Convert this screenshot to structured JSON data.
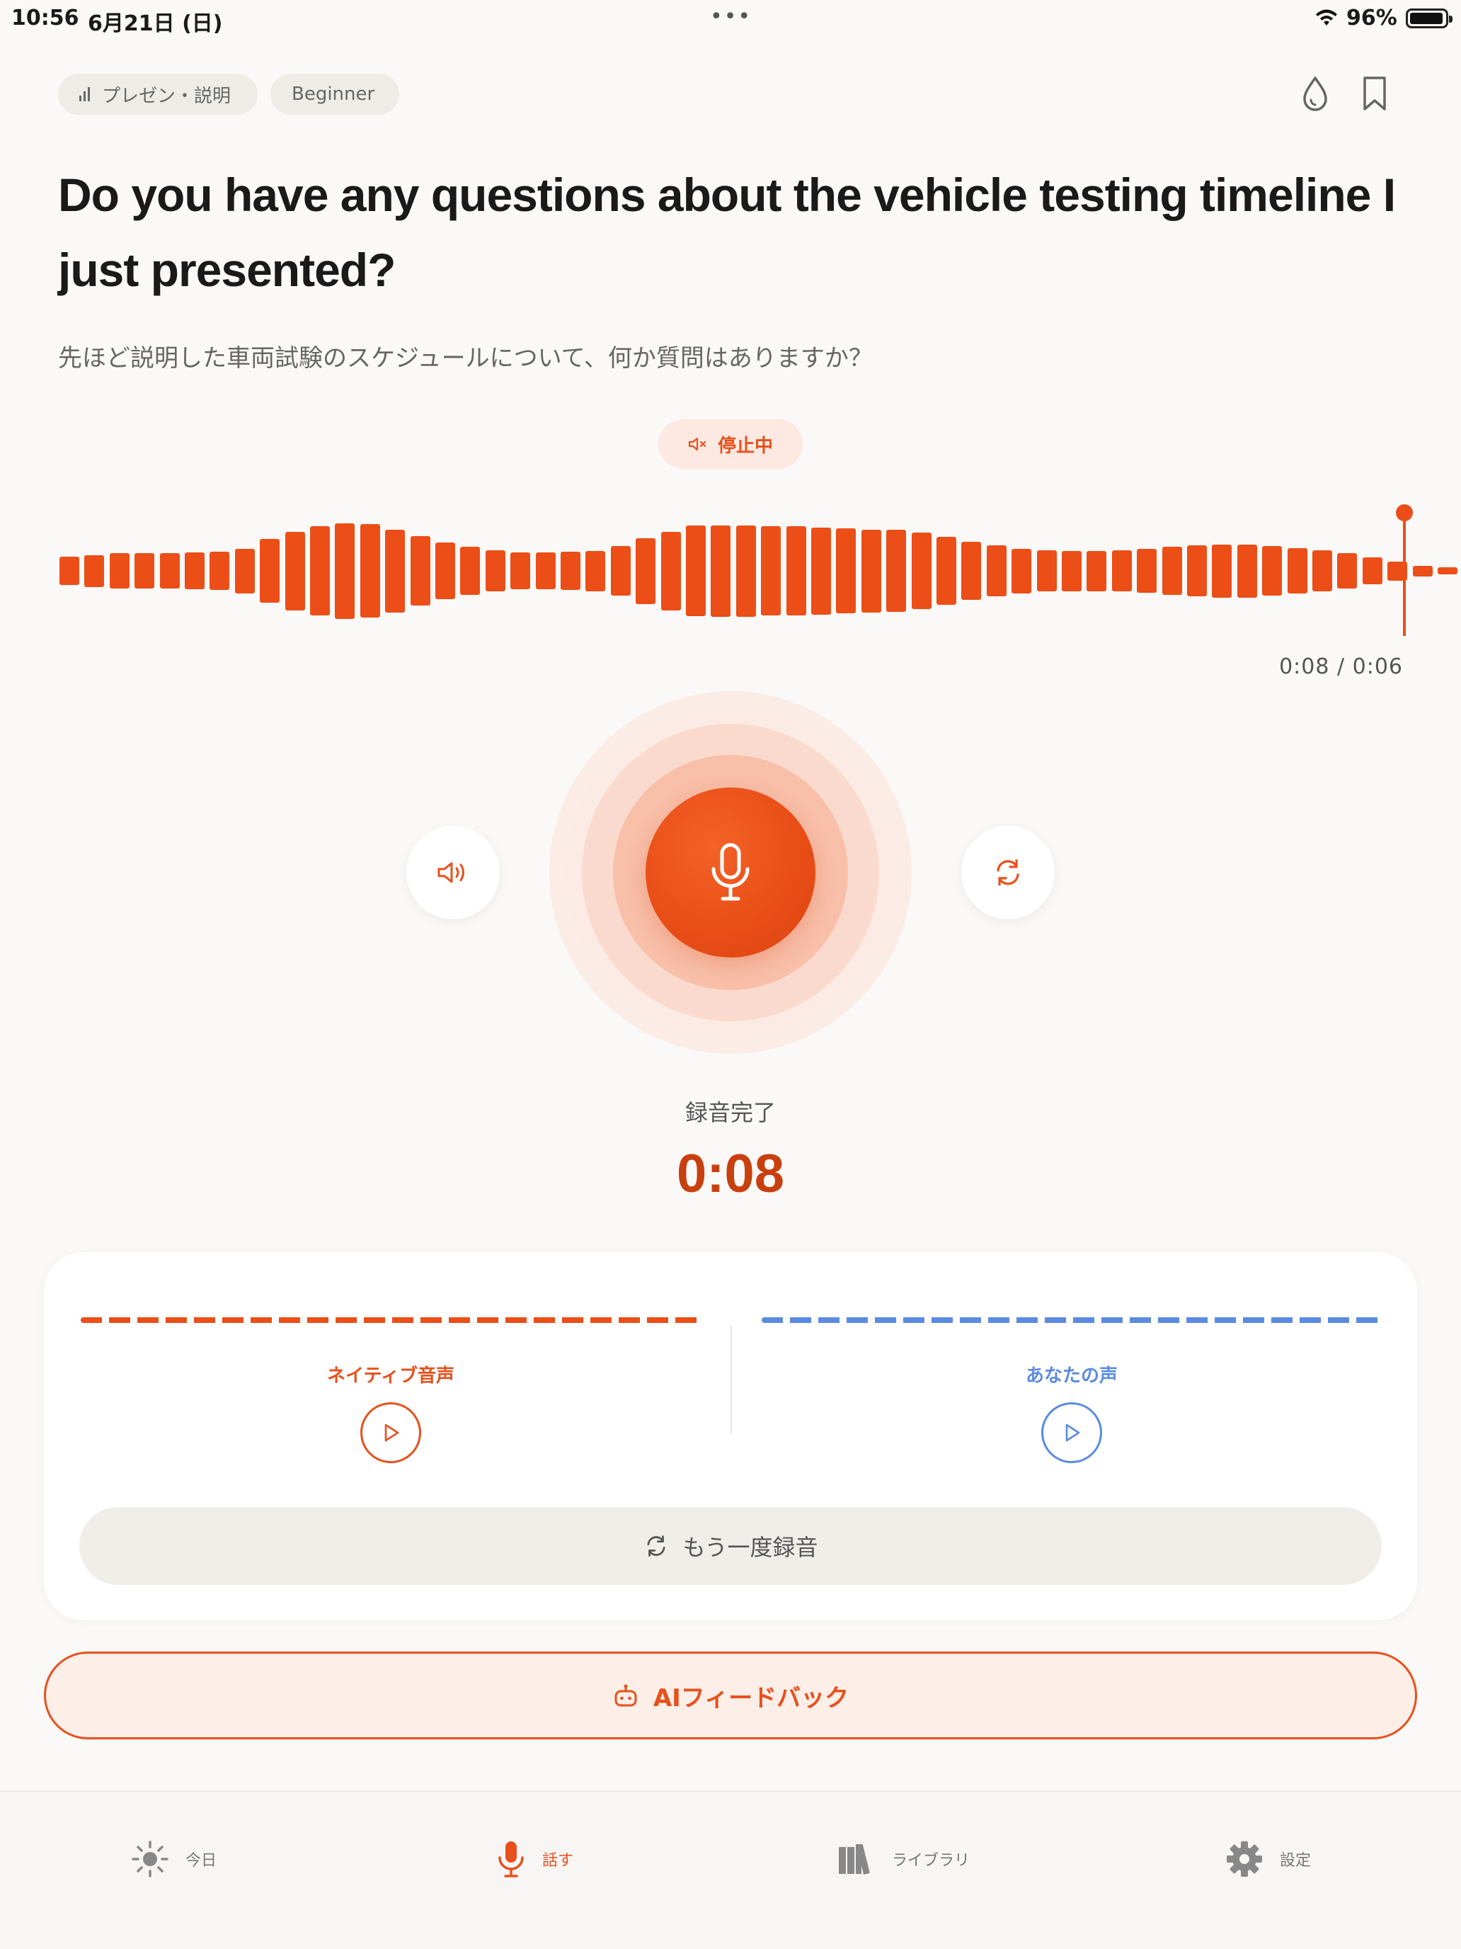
{
  "status_bar": {
    "time": "10:56",
    "date": "6月21日 (日)",
    "dots": "•••",
    "battery_percent": "96%",
    "battery_level": 0.96
  },
  "tags": {
    "category": "プレゼン・説明",
    "level": "Beginner"
  },
  "question": {
    "english": "Do you have any questions about the vehicle testing timeline I just presented?",
    "japanese": "先ほど説明した車両試験のスケジュールについて、何か質問はありますか？"
  },
  "playback_state": {
    "label": "停止中"
  },
  "waveform": {
    "color": "#ec4e18",
    "levels": [
      0.27,
      0.3,
      0.33,
      0.33,
      0.33,
      0.35,
      0.36,
      0.42,
      0.6,
      0.74,
      0.84,
      0.9,
      0.88,
      0.78,
      0.65,
      0.53,
      0.45,
      0.39,
      0.35,
      0.35,
      0.36,
      0.38,
      0.47,
      0.62,
      0.74,
      0.85,
      0.86,
      0.86,
      0.84,
      0.84,
      0.82,
      0.8,
      0.78,
      0.77,
      0.72,
      0.64,
      0.55,
      0.48,
      0.42,
      0.39,
      0.38,
      0.38,
      0.39,
      0.41,
      0.45,
      0.48,
      0.5,
      0.5,
      0.47,
      0.43,
      0.39,
      0.33,
      0.25,
      0.18,
      0.1,
      0.07,
      0.06
    ],
    "time_readout": "0:08 / 0:06"
  },
  "recording": {
    "status": "録音完了",
    "duration": "0:08"
  },
  "compare": {
    "native_label": "ネイティブ音声",
    "your_label": "あなたの声",
    "native_color": "#e8501c",
    "your_color": "#5b8be0",
    "rerecord_label": "もう一度録音"
  },
  "ai_feedback": {
    "label": "AIフィードバック"
  },
  "tab_bar": {
    "active": "speak",
    "items": [
      {
        "id": "today",
        "label": "今日",
        "icon": "sun-icon"
      },
      {
        "id": "speak",
        "label": "話す",
        "icon": "mic-icon"
      },
      {
        "id": "library",
        "label": "ライブラリ",
        "icon": "books-icon"
      },
      {
        "id": "settings",
        "label": "設定",
        "icon": "gear-icon"
      }
    ]
  },
  "accent_color": "#e8501c"
}
